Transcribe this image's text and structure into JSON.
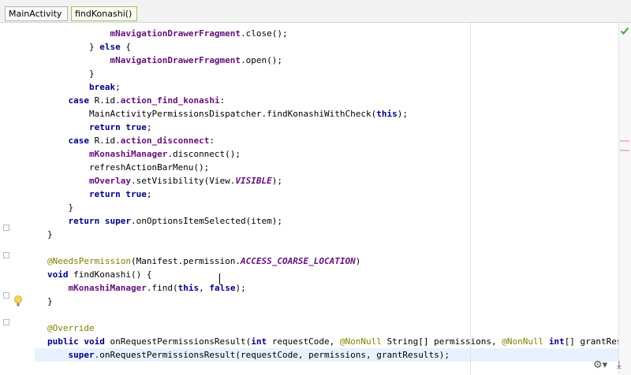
{
  "breadcrumbs": [
    {
      "label": "MainActivity"
    },
    {
      "label": "findKonashi()"
    }
  ],
  "colors": {
    "keyword": "#000080",
    "field": "#660e7a",
    "annotation": "#808000",
    "current_line": "#e8f2fe",
    "ok_check": "#3eaa3e"
  },
  "code_lines": [
    {
      "parts": [
        {
          "t": "            ",
          "c": ""
        },
        {
          "t": "mNavigationDrawerFragment",
          "c": "fld"
        },
        {
          "t": ".close();",
          "c": ""
        }
      ]
    },
    {
      "parts": [
        {
          "t": "        } ",
          "c": ""
        },
        {
          "t": "else",
          "c": "kw"
        },
        {
          "t": " {",
          "c": ""
        }
      ]
    },
    {
      "parts": [
        {
          "t": "            ",
          "c": ""
        },
        {
          "t": "mNavigationDrawerFragment",
          "c": "fld"
        },
        {
          "t": ".open();",
          "c": ""
        }
      ]
    },
    {
      "parts": [
        {
          "t": "        }",
          "c": ""
        }
      ]
    },
    {
      "parts": [
        {
          "t": "        ",
          "c": ""
        },
        {
          "t": "break",
          "c": "kw"
        },
        {
          "t": ";",
          "c": ""
        }
      ]
    },
    {
      "parts": [
        {
          "t": "    ",
          "c": ""
        },
        {
          "t": "case",
          "c": "kw"
        },
        {
          "t": " R.id.",
          "c": ""
        },
        {
          "t": "action_find_konashi",
          "c": "fld"
        },
        {
          "t": ":",
          "c": ""
        }
      ]
    },
    {
      "parts": [
        {
          "t": "        MainActivityPermissionsDispatcher.findKonashiWithCheck(",
          "c": ""
        },
        {
          "t": "this",
          "c": "kw"
        },
        {
          "t": ");",
          "c": ""
        }
      ]
    },
    {
      "parts": [
        {
          "t": "        ",
          "c": ""
        },
        {
          "t": "return true",
          "c": "kw"
        },
        {
          "t": ";",
          "c": ""
        }
      ]
    },
    {
      "parts": [
        {
          "t": "    ",
          "c": ""
        },
        {
          "t": "case",
          "c": "kw"
        },
        {
          "t": " R.id.",
          "c": ""
        },
        {
          "t": "action_disconnect",
          "c": "fld"
        },
        {
          "t": ":",
          "c": ""
        }
      ]
    },
    {
      "parts": [
        {
          "t": "        ",
          "c": ""
        },
        {
          "t": "mKonashiManager",
          "c": "fld"
        },
        {
          "t": ".disconnect();",
          "c": ""
        }
      ]
    },
    {
      "parts": [
        {
          "t": "        refreshActionBarMenu();",
          "c": ""
        }
      ]
    },
    {
      "parts": [
        {
          "t": "        ",
          "c": ""
        },
        {
          "t": "mOverlay",
          "c": "fld"
        },
        {
          "t": ".setVisibility(View.",
          "c": ""
        },
        {
          "t": "VISIBLE",
          "c": "cst"
        },
        {
          "t": ");",
          "c": ""
        }
      ]
    },
    {
      "parts": [
        {
          "t": "        ",
          "c": ""
        },
        {
          "t": "return true",
          "c": "kw"
        },
        {
          "t": ";",
          "c": ""
        }
      ]
    },
    {
      "parts": [
        {
          "t": "    }",
          "c": ""
        }
      ]
    },
    {
      "parts": [
        {
          "t": "    ",
          "c": ""
        },
        {
          "t": "return super",
          "c": "kw"
        },
        {
          "t": ".onOptionsItemSelected(item);",
          "c": ""
        }
      ]
    },
    {
      "parts": [
        {
          "t": "}",
          "c": ""
        }
      ]
    },
    {
      "parts": [
        {
          "t": "",
          "c": ""
        }
      ]
    },
    {
      "parts": [
        {
          "t": "@NeedsPermission",
          "c": "ann"
        },
        {
          "t": "(Manifest.permission.",
          "c": ""
        },
        {
          "t": "ACCESS_COARSE_LOCATION",
          "c": "cst"
        },
        {
          "t": ")",
          "c": ""
        }
      ]
    },
    {
      "parts": [
        {
          "t": "void",
          "c": "kw"
        },
        {
          "t": " findKonashi() {",
          "c": ""
        }
      ]
    },
    {
      "parts": [
        {
          "t": "    ",
          "c": ""
        },
        {
          "t": "mKonashiManager",
          "c": "fld"
        },
        {
          "t": ".find(",
          "c": ""
        },
        {
          "t": "this",
          "c": "kw"
        },
        {
          "t": ", ",
          "c": ""
        },
        {
          "t": "false",
          "c": "kw"
        },
        {
          "t": ");",
          "c": ""
        }
      ]
    },
    {
      "parts": [
        {
          "t": "}",
          "c": ""
        }
      ]
    },
    {
      "parts": [
        {
          "t": "",
          "c": ""
        }
      ]
    },
    {
      "parts": [
        {
          "t": "@Override",
          "c": "ann"
        }
      ]
    },
    {
      "parts": [
        {
          "t": "public void",
          "c": "kw"
        },
        {
          "t": " onRequestPermissionsResult(",
          "c": ""
        },
        {
          "t": "int",
          "c": "kw"
        },
        {
          "t": " requestCode, ",
          "c": ""
        },
        {
          "t": "@NonNull",
          "c": "ann"
        },
        {
          "t": " String[] permissions, ",
          "c": ""
        },
        {
          "t": "@NonNull",
          "c": "ann"
        },
        {
          "t": " ",
          "c": ""
        },
        {
          "t": "int",
          "c": "kw"
        },
        {
          "t": "[] grantResults) {",
          "c": ""
        }
      ]
    },
    {
      "parts": [
        {
          "t": "    ",
          "c": ""
        },
        {
          "t": "super",
          "c": "kw"
        },
        {
          "t": ".onRequestPermissionsResult(requestCode, permissions, grantResults);",
          "c": ""
        }
      ]
    }
  ],
  "status_icons": [
    "gear-icon",
    "download-icon"
  ]
}
